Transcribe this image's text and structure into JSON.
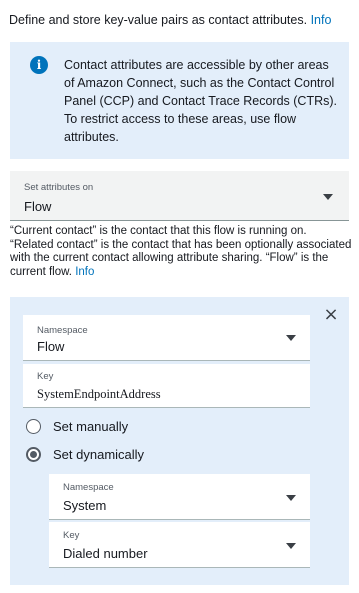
{
  "intro": {
    "text": "Define and store key-value pairs as contact attributes.",
    "link": "Info"
  },
  "info_box": {
    "icon": "info-icon",
    "text": "Contact attributes are accessible by other areas of Amazon Connect, such as the Contact Control Panel (CCP) and Contact Trace Records (CTRs). To restrict access to these areas, use flow attributes."
  },
  "set_attributes_on": {
    "label": "Set attributes on",
    "value": "Flow"
  },
  "help": {
    "text": "“Current contact” is the contact that this flow is running on. “Related contact” is the contact that has been optionally associated with the current contact allowing attribute sharing. “Flow” is the current flow.",
    "link": "Info"
  },
  "attribute": {
    "namespace_label": "Namespace",
    "namespace_value": "Flow",
    "key_label": "Key",
    "key_value": "SystemEndpointAddress",
    "radio_manual": "Set manually",
    "radio_dynamic": "Set dynamically",
    "selected_mode": "Set dynamically",
    "dynamic": {
      "namespace_label": "Namespace",
      "namespace_value": "System",
      "key_label": "Key",
      "key_value": "Dialed number"
    }
  },
  "colors": {
    "accent": "#0073bb",
    "panel_bg": "#e3eefa",
    "select_bg": "#f2f3f3"
  }
}
